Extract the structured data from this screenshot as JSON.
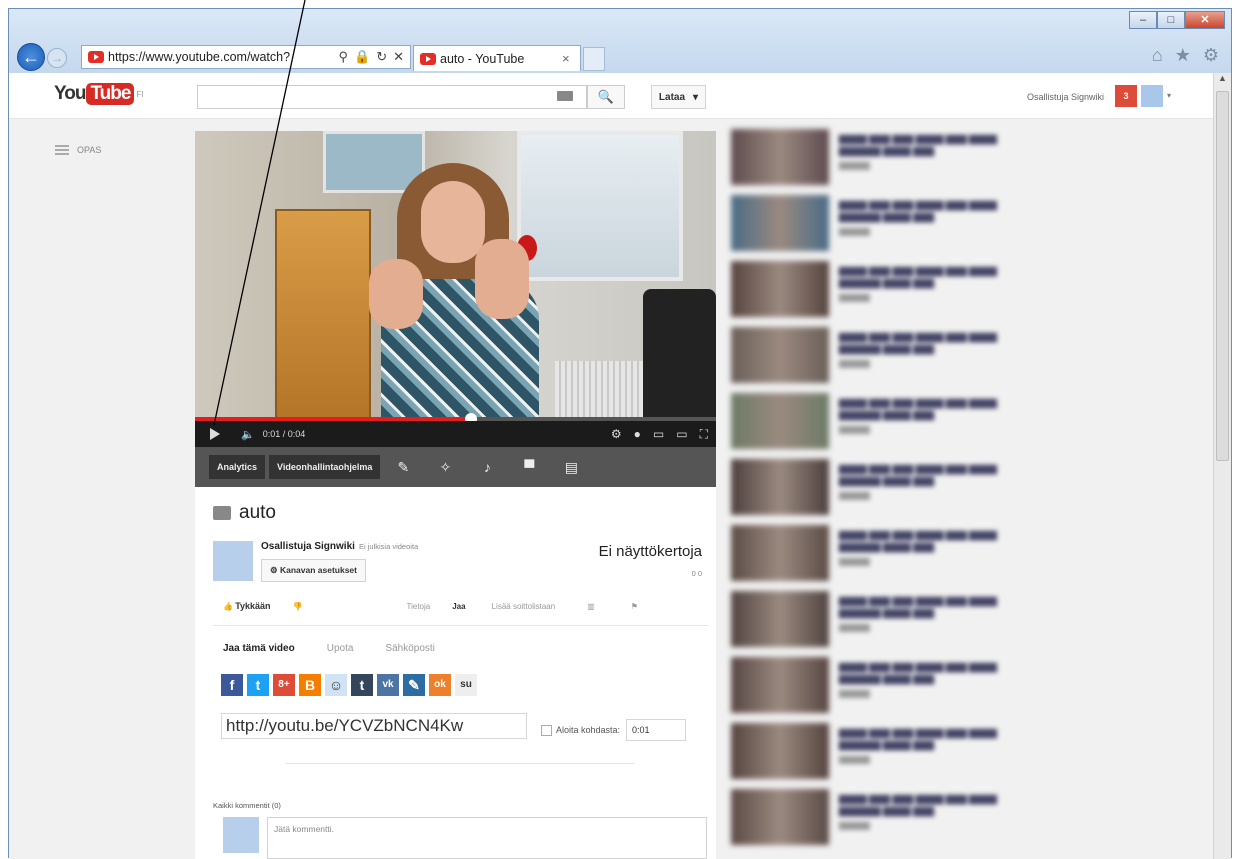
{
  "browser": {
    "address": "https://www.youtube.com/watch?",
    "tab_title": "auto - YouTube",
    "tab_close": "×",
    "back_glyph": "←",
    "forward_glyph": "→",
    "window_buttons": {
      "minimize": "–",
      "maximize": "□",
      "close": "✕"
    },
    "right_icons": [
      "home-icon",
      "favorites-star-icon",
      "settings-gear-icon"
    ]
  },
  "youtube": {
    "logo_you": "You",
    "logo_tube": "Tube",
    "logo_region": "FI",
    "search_placeholder": "",
    "search_glyph": "🔍",
    "upload_label": "Lataa",
    "upload_caret": "▾",
    "user_name": "Osallistuja Signwiki",
    "notifications": "3",
    "guide_label": "OPAS"
  },
  "player": {
    "time": "0:01 / 0:04",
    "progress": 0.53,
    "analytics_label": "Analytics",
    "manager_label": "Videonhallintaohjelma"
  },
  "video": {
    "title": "auto",
    "channel": "Osallistuja Signwiki",
    "channel_sub": "Ei julkisia videoita",
    "channel_settings": "Kanavan asetukset",
    "views": "Ei näyttökertoja",
    "likes_summary": "0     0",
    "like_label": "Tykkään",
    "actions": [
      "Tietoja",
      "Jaa",
      "Lisää soittolistaan"
    ]
  },
  "share": {
    "tabs": [
      "Jaa tämä video",
      "Upota",
      "Sähköposti"
    ],
    "short_link": "http://youtu.be/YCVZbNCN4Kw",
    "start_label": "Aloita kohdasta:",
    "start_value": "0:01",
    "social": [
      {
        "name": "facebook",
        "glyph": "f",
        "color": "#3b5998"
      },
      {
        "name": "twitter",
        "glyph": "t",
        "color": "#1da1f2"
      },
      {
        "name": "google-plus",
        "glyph": "8+",
        "color": "#dd4b39"
      },
      {
        "name": "blogger",
        "glyph": "B",
        "color": "#f57d00"
      },
      {
        "name": "reddit",
        "glyph": "☺",
        "color": "#cfe3f5"
      },
      {
        "name": "tumblr",
        "glyph": "t",
        "color": "#35465c"
      },
      {
        "name": "vk",
        "glyph": "vk",
        "color": "#4c75a3"
      },
      {
        "name": "livejournal",
        "glyph": "✎",
        "color": "#2e6da4"
      },
      {
        "name": "odnoklassniki",
        "glyph": "ok",
        "color": "#ed812b"
      },
      {
        "name": "stumbleupon",
        "glyph": "su",
        "color": "#eeeeee"
      }
    ]
  },
  "comments": {
    "header": "Kaikki kommentit (0)",
    "placeholder": "Jätä kommentti."
  },
  "related": [
    {
      "thumb_color": "#5e4b4f"
    },
    {
      "thumb_color": "#4a6b86"
    },
    {
      "thumb_color": "#56433e"
    },
    {
      "thumb_color": "#6a5f58"
    },
    {
      "thumb_color": "#6d7a66"
    },
    {
      "thumb_color": "#4d3f3d"
    },
    {
      "thumb_color": "#5b4c46"
    },
    {
      "thumb_color": "#514340"
    },
    {
      "thumb_color": "#574643"
    },
    {
      "thumb_color": "#55443f"
    },
    {
      "thumb_color": "#5b4a46"
    }
  ]
}
